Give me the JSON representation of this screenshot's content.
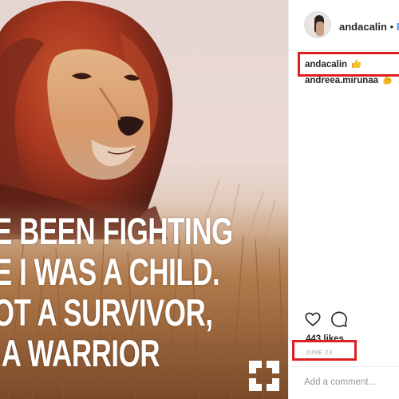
{
  "post": {
    "image_quote_lines": [
      "E BEEN FIGHTING",
      "E I WAS A CHILD.",
      "IOT A SURVIVOR,",
      "I A WARRIOR"
    ],
    "brand_logo_icon": "square-c-logo-icon"
  },
  "header": {
    "username": "andacalin",
    "separator": "•",
    "follow_label": "Fo"
  },
  "comments": [
    {
      "user": "andacalin",
      "emoji": "thumbs-up-emoji"
    },
    {
      "user": "andreea.mirunaa",
      "emoji": "flexed-biceps-emoji"
    }
  ],
  "actions": {
    "like_icon": "heart-icon",
    "comment_icon": "comment-bubble-icon",
    "likes_text": "443 likes",
    "date_text": "JUNE 23"
  },
  "comment_box": {
    "placeholder": "Add a comment..."
  },
  "colors": {
    "link_blue": "#3897f0",
    "highlight_red": "#e02020",
    "text_dark": "#262626",
    "text_muted": "#999999"
  }
}
